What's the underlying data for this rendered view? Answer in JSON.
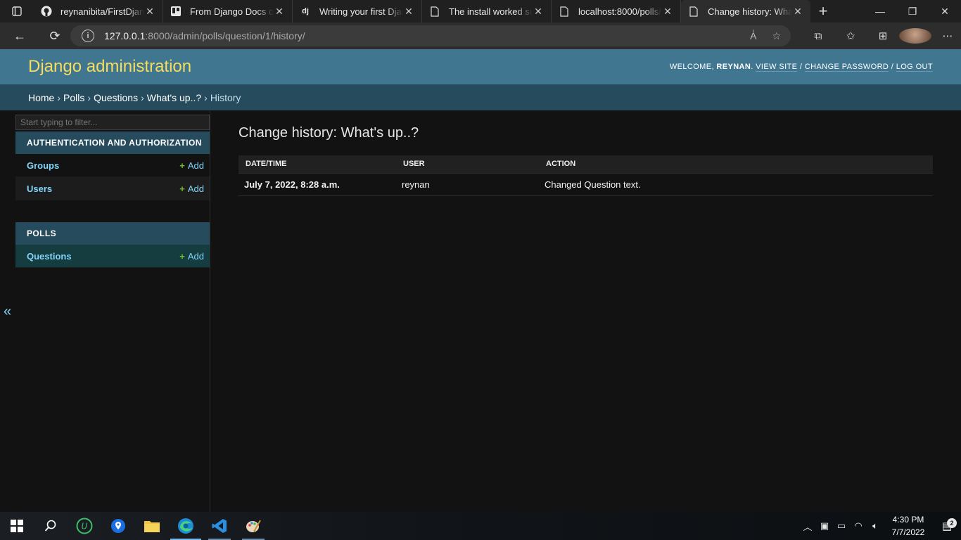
{
  "browser": {
    "tabs": [
      {
        "title": "reynanibita/FirstDjango",
        "favicon": "github-icon"
      },
      {
        "title": "From Django Docs on",
        "favicon": "trello-icon"
      },
      {
        "title": "Writing your first Django",
        "favicon": "dj"
      },
      {
        "title": "The install worked succ",
        "favicon": "page-icon"
      },
      {
        "title": "localhost:8000/polls/",
        "favicon": "page-icon"
      },
      {
        "title": "Change history: What's",
        "favicon": "page-icon",
        "active": true
      }
    ],
    "url_host": "127.0.0.1",
    "url_path": ":8000/admin/polls/question/1/history/"
  },
  "header": {
    "site_name": "Django administration",
    "welcome": "WELCOME,",
    "username": "REYNAN",
    "view_site": "VIEW SITE",
    "change_password": "CHANGE PASSWORD",
    "logout": "LOG OUT",
    "sep": "/"
  },
  "breadcrumbs": {
    "home": "Home",
    "app": "Polls",
    "model": "Questions",
    "object": "What's up..?",
    "current": "History",
    "sep": "›"
  },
  "sidebar": {
    "filter_placeholder": "Start typing to filter...",
    "modules": [
      {
        "caption": "AUTHENTICATION AND AUTHORIZATION",
        "models": [
          {
            "name": "Groups",
            "add": "Add"
          },
          {
            "name": "Users",
            "add": "Add"
          }
        ]
      },
      {
        "caption": "POLLS",
        "models": [
          {
            "name": "Questions",
            "add": "Add"
          }
        ]
      }
    ],
    "collapse": "«"
  },
  "main": {
    "title": "Change history: What's up..?",
    "columns": [
      "DATE/TIME",
      "USER",
      "ACTION"
    ],
    "rows": [
      {
        "datetime": "July 7, 2022, 8:28 a.m.",
        "user": "reynan",
        "action": "Changed Question text."
      }
    ]
  },
  "taskbar": {
    "time": "4:30 PM",
    "date": "7/7/2022",
    "notifications": "2"
  },
  "colors": {
    "header_bg": "#417690",
    "breadcrumb_bg": "#264b5d",
    "site_name": "#f5dd5d",
    "link": "#81d4fa",
    "add_plus": "#70bf2b"
  }
}
